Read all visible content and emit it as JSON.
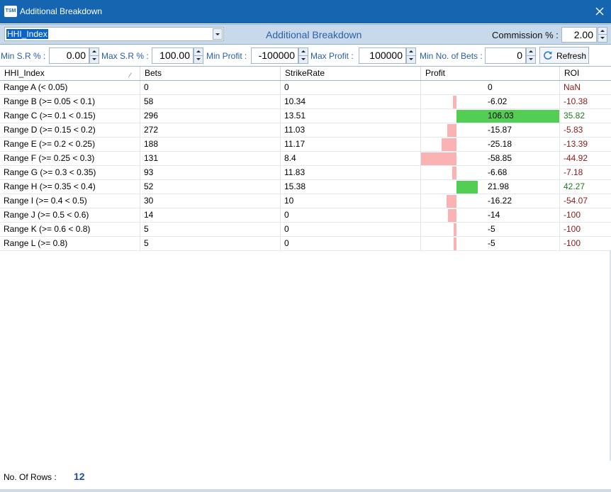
{
  "window": {
    "title": "Additional Breakdown",
    "app_icon": "TSM"
  },
  "header": {
    "selected_field": "HHI_Index",
    "title": "Additional Breakdown",
    "commission_label": "Commission % :",
    "commission_value": "2.00"
  },
  "filters": {
    "min_sr_label": "Min S.R % :",
    "min_sr_value": "0.00",
    "max_sr_label": "Max S.R % :",
    "max_sr_value": "100.00",
    "min_profit_label": "Min Profit :",
    "min_profit_value": "-100000",
    "max_profit_label": "Max Profit :",
    "max_profit_value": "100000",
    "min_bets_label": "Min No. of Bets :",
    "min_bets_value": "0",
    "refresh_label": "Refresh"
  },
  "grid": {
    "columns": [
      "HHI_Index",
      "Bets",
      "StrikeRate",
      "Profit",
      "ROI"
    ],
    "rows": [
      {
        "index": "Range A  (< 0.05)",
        "bets": "0",
        "strike_rate": "0",
        "profit": "0",
        "profit_num": 0,
        "roi": "NaN"
      },
      {
        "index": "Range B  (>= 0.05 < 0.1)",
        "bets": "58",
        "strike_rate": "10.34",
        "profit": "-6.02",
        "profit_num": -6.02,
        "roi": "-10.38"
      },
      {
        "index": "Range C  (>= 0.1 < 0.15)",
        "bets": "296",
        "strike_rate": "13.51",
        "profit": "106.03",
        "profit_num": 106.03,
        "roi": "35.82"
      },
      {
        "index": "Range D  (>= 0.15 < 0.2)",
        "bets": "272",
        "strike_rate": "11.03",
        "profit": "-15.87",
        "profit_num": -15.87,
        "roi": "-5.83"
      },
      {
        "index": "Range E  (>= 0.2 < 0.25)",
        "bets": "188",
        "strike_rate": "11.17",
        "profit": "-25.18",
        "profit_num": -25.18,
        "roi": "-13.39"
      },
      {
        "index": "Range F  (>= 0.25 < 0.3)",
        "bets": "131",
        "strike_rate": "8.4",
        "profit": "-58.85",
        "profit_num": -58.85,
        "roi": "-44.92"
      },
      {
        "index": "Range G  (>= 0.3 < 0.35)",
        "bets": "93",
        "strike_rate": "11.83",
        "profit": "-6.68",
        "profit_num": -6.68,
        "roi": "-7.18"
      },
      {
        "index": "Range H  (>= 0.35 < 0.4)",
        "bets": "52",
        "strike_rate": "15.38",
        "profit": "21.98",
        "profit_num": 21.98,
        "roi": "42.27"
      },
      {
        "index": "Range I  (>= 0.4 < 0.5)",
        "bets": "30",
        "strike_rate": "10",
        "profit": "-16.22",
        "profit_num": -16.22,
        "roi": "-54.07"
      },
      {
        "index": "Range J  (>= 0.5 < 0.6)",
        "bets": "14",
        "strike_rate": "0",
        "profit": "-14",
        "profit_num": -14,
        "roi": "-100"
      },
      {
        "index": "Range K  (>= 0.6 < 0.8)",
        "bets": "5",
        "strike_rate": "0",
        "profit": "-5",
        "profit_num": -5,
        "roi": "-100"
      },
      {
        "index": "Range L  (>= 0.8)",
        "bets": "5",
        "strike_rate": "0",
        "profit": "-5",
        "profit_num": -5,
        "roi": "-100"
      }
    ]
  },
  "footer": {
    "rows_label": "No. Of Rows :",
    "rows_count": "12"
  },
  "colors": {
    "title_bar": "#1565b0",
    "positive_bar": "#52cf52",
    "negative_bar": "#fbb2b2",
    "roi_negative": "#8b1a1a",
    "roi_positive": "#1f7a1f",
    "accent_text": "#2a60a8"
  }
}
